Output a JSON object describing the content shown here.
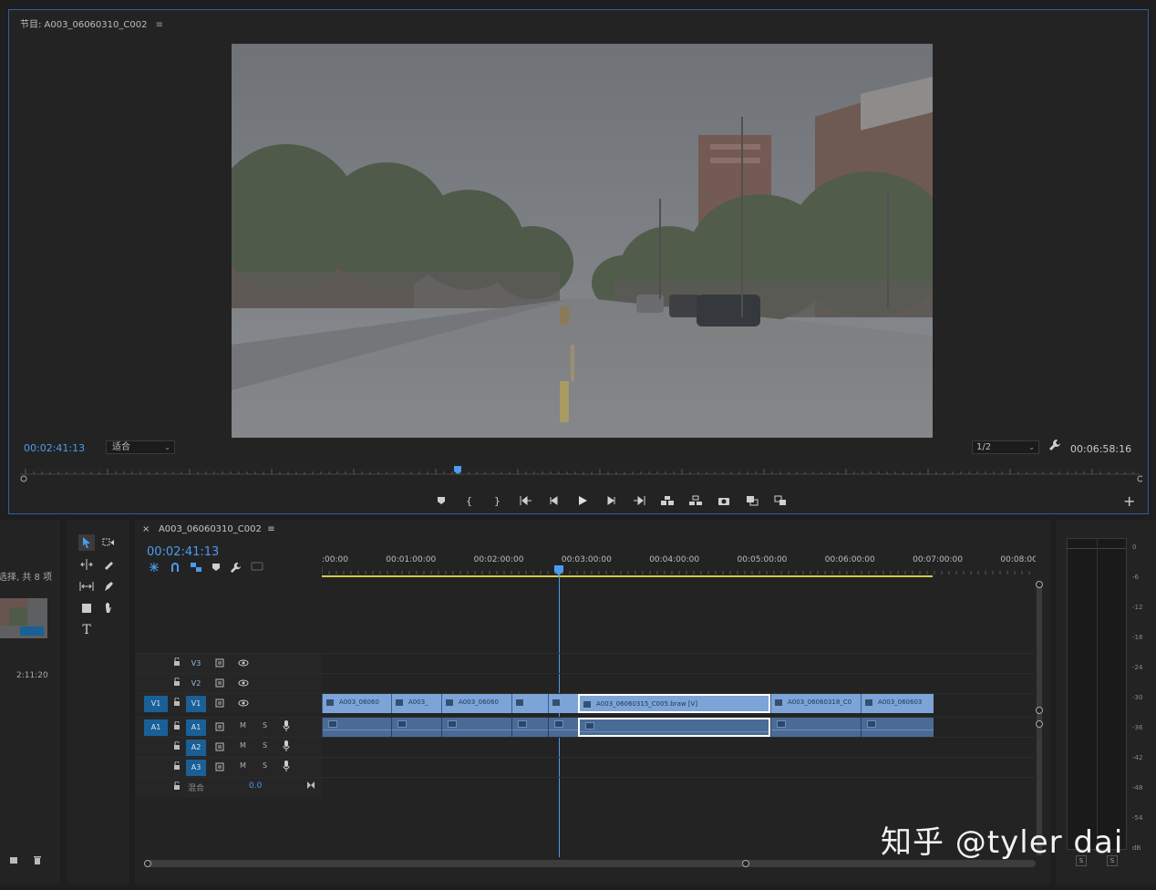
{
  "monitor": {
    "title": "节目: A003_06060310_C002",
    "menu_glyph": "≡",
    "timecode_current": "00:02:41:13",
    "fit_select": "适合",
    "resolution_select": "1/2",
    "timecode_duration": "00:06:58:16",
    "add_button": "+"
  },
  "project": {
    "item_count_text": "选择, 共 8 项",
    "clip_duration": "2:11:20"
  },
  "timeline": {
    "tab_close": "×",
    "tab_title": "A003_06060310_C002",
    "tab_menu": "≡",
    "timecode": "00:02:41:13",
    "ruler_labels": [
      ":00:00",
      "00:01:00:00",
      "00:02:00:00",
      "00:03:00:00",
      "00:04:00:00",
      "00:05:00:00",
      "00:06:00:00",
      "00:07:00:00",
      "00:08:0C"
    ],
    "tracks": {
      "v3": "V3",
      "v2": "V2",
      "v1": "V1",
      "v1_source": "V1",
      "a1": "A1",
      "a1_source": "A1",
      "a2": "A2",
      "a3": "A3",
      "mix_label": "混合",
      "mix_value": "0.0",
      "mute": "M",
      "solo": "S"
    },
    "clips": [
      {
        "name": "A003_06060"
      },
      {
        "name": "A003_"
      },
      {
        "name": "A003_06060"
      },
      {
        "name": ""
      },
      {
        "name": ""
      },
      {
        "name": "A003_06060315_C005.braw [V]"
      },
      {
        "name": "A003_06060318_C0"
      },
      {
        "name": "A003_060603"
      }
    ]
  },
  "meter": {
    "db_labels": [
      "0",
      "-6",
      "-12",
      "-18",
      "-24",
      "-30",
      "-36",
      "-42",
      "-48",
      "-54",
      "dB"
    ],
    "solo_left": "S",
    "solo_right": "S"
  },
  "watermark": "知乎 @tyler dai",
  "colors": {
    "accent": "#4b9cf0",
    "clip_video": "#7ca4d6",
    "clip_audio": "#4a6b96",
    "target_on": "#1a5f96"
  }
}
